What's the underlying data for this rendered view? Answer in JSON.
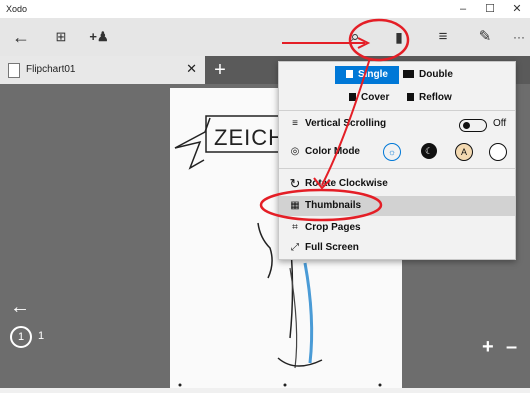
{
  "app": {
    "title": "Xodo"
  },
  "window": {
    "minimize": "–",
    "maximize": "☐",
    "close": "✕"
  },
  "toolbar": {
    "back": "←",
    "bookmark": "⊞",
    "add_user": "+♟",
    "search": "⌕",
    "view_mode": "▮",
    "outline": "≡",
    "annotate": "✎",
    "more": "···"
  },
  "tabs": [
    {
      "label": "Flipchart01",
      "close": "✕"
    }
  ],
  "tabbar": {
    "add": "+"
  },
  "viewer": {
    "back": "←",
    "page_current": "1",
    "page_total": "1",
    "zoom_in": "+",
    "zoom_out": "–"
  },
  "menu": {
    "single": "Single",
    "double": "Double",
    "cover": "Cover",
    "reflow": "Reflow",
    "vertical_scrolling": "Vertical Scrolling",
    "vertical_scrolling_state": "Off",
    "color_mode": "Color Mode",
    "color_mode_auto": "A",
    "rotate": "Rotate Clockwise",
    "thumbnails": "Thumbnails",
    "crop": "Crop Pages",
    "fullscreen": "Full Screen"
  },
  "page_content": {
    "heading": "ZEICH"
  },
  "colors": {
    "accent": "#0078d7",
    "annotation": "#e41e26",
    "viewer_bg": "#6d6d6d"
  }
}
